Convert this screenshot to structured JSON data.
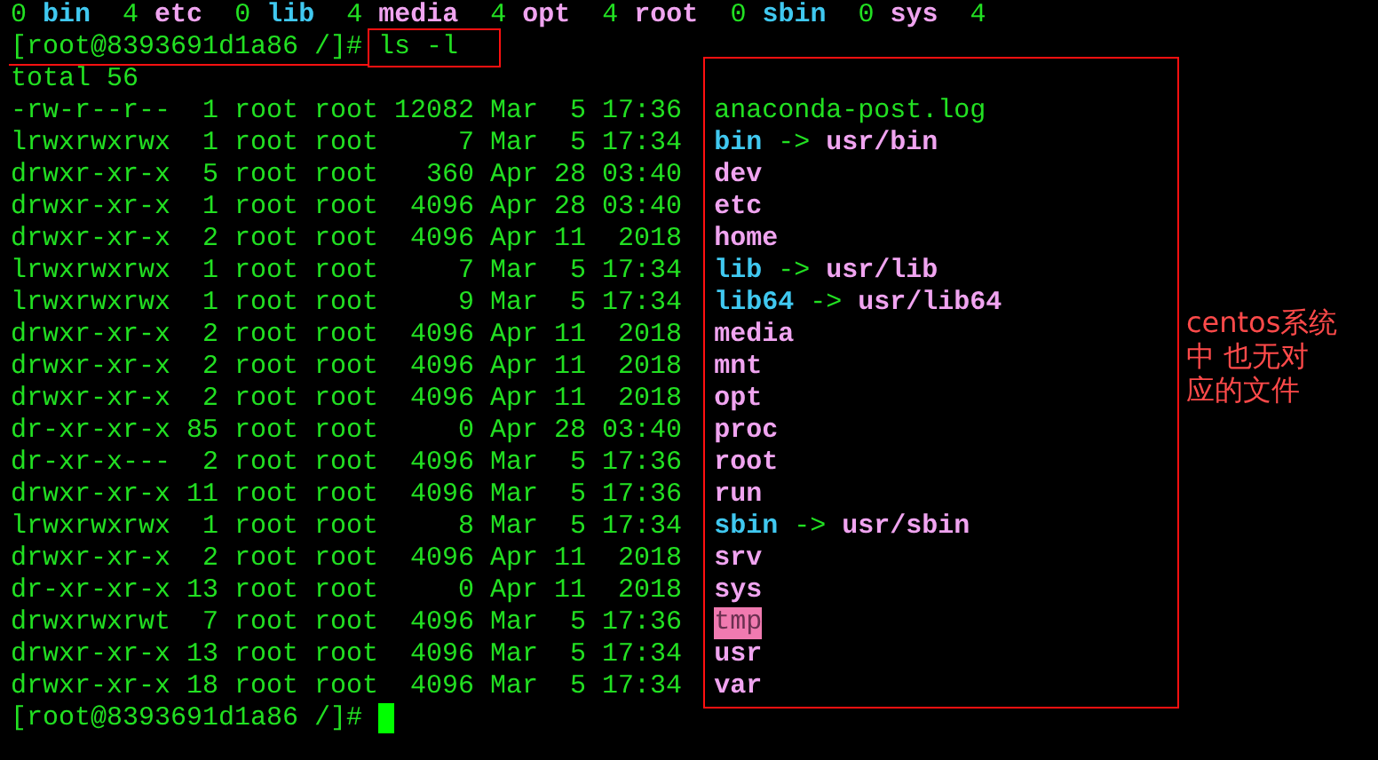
{
  "previous_output": [
    {
      "count": "0",
      "name": "bin",
      "kind": "link"
    },
    {
      "count": "4",
      "name": "etc",
      "kind": "dir"
    },
    {
      "count": "0",
      "name": "lib",
      "kind": "link"
    },
    {
      "count": "4",
      "name": "media",
      "kind": "dir"
    },
    {
      "count": "4",
      "name": "opt",
      "kind": "dir"
    },
    {
      "count": "4",
      "name": "root",
      "kind": "dir"
    },
    {
      "count": "0",
      "name": "sbin",
      "kind": "link"
    },
    {
      "count": "0",
      "name": "sys",
      "kind": "dir"
    },
    {
      "count": "4"
    }
  ],
  "prompt": {
    "text": "[root@8393691d1a86 /]#",
    "command": "ls -l"
  },
  "total": "total 56",
  "entries": [
    {
      "info": "-rw-r--r--  1 root root 12082 Mar  5 17:36",
      "name": "anaconda-post.log",
      "kind": "file"
    },
    {
      "info": "lrwxrwxrwx  1 root root     7 Mar  5 17:34",
      "name": "bin",
      "kind": "link",
      "arrow": "->",
      "target": "usr/bin"
    },
    {
      "info": "drwxr-xr-x  5 root root   360 Apr 28 03:40",
      "name": "dev",
      "kind": "dir"
    },
    {
      "info": "drwxr-xr-x  1 root root  4096 Apr 28 03:40",
      "name": "etc",
      "kind": "dir"
    },
    {
      "info": "drwxr-xr-x  2 root root  4096 Apr 11  2018",
      "name": "home",
      "kind": "dir"
    },
    {
      "info": "lrwxrwxrwx  1 root root     7 Mar  5 17:34",
      "name": "lib",
      "kind": "link",
      "arrow": "->",
      "target": "usr/lib"
    },
    {
      "info": "lrwxrwxrwx  1 root root     9 Mar  5 17:34",
      "name": "lib64",
      "kind": "link",
      "arrow": "->",
      "target": "usr/lib64"
    },
    {
      "info": "drwxr-xr-x  2 root root  4096 Apr 11  2018",
      "name": "media",
      "kind": "dir"
    },
    {
      "info": "drwxr-xr-x  2 root root  4096 Apr 11  2018",
      "name": "mnt",
      "kind": "dir"
    },
    {
      "info": "drwxr-xr-x  2 root root  4096 Apr 11  2018",
      "name": "opt",
      "kind": "dir"
    },
    {
      "info": "dr-xr-xr-x 85 root root     0 Apr 28 03:40",
      "name": "proc",
      "kind": "dir"
    },
    {
      "info": "dr-xr-x---  2 root root  4096 Mar  5 17:36",
      "name": "root",
      "kind": "dir"
    },
    {
      "info": "drwxr-xr-x 11 root root  4096 Mar  5 17:36",
      "name": "run",
      "kind": "dir"
    },
    {
      "info": "lrwxrwxrwx  1 root root     8 Mar  5 17:34",
      "name": "sbin",
      "kind": "link",
      "arrow": "->",
      "target": "usr/sbin"
    },
    {
      "info": "drwxr-xr-x  2 root root  4096 Apr 11  2018",
      "name": "srv",
      "kind": "dir"
    },
    {
      "info": "dr-xr-xr-x 13 root root     0 Apr 11  2018",
      "name": "sys",
      "kind": "dir"
    },
    {
      "info": "drwxrwxrwt  7 root root  4096 Mar  5 17:36",
      "name": "tmp",
      "kind": "sticky"
    },
    {
      "info": "drwxr-xr-x 13 root root  4096 Mar  5 17:34",
      "name": "usr",
      "kind": "dir"
    },
    {
      "info": "drwxr-xr-x 18 root root  4096 Mar  5 17:34",
      "name": "var",
      "kind": "dir"
    }
  ],
  "final_prompt": {
    "text": "[root@8393691d1a86 /]#"
  },
  "note": [
    "centos系统",
    "中 也无对",
    "应的文件"
  ]
}
